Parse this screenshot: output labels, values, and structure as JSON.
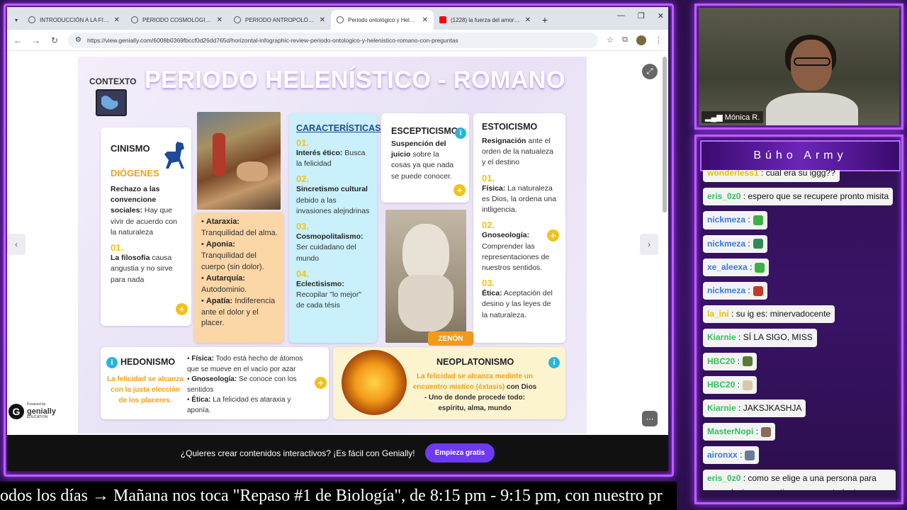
{
  "browser": {
    "tabs": [
      {
        "title": "INTRODUCCIÓN A LA FILOSOFÍ",
        "active": false
      },
      {
        "title": "PERIODO COSMOLÓGICO | Ge",
        "active": false
      },
      {
        "title": "PERIODO ANTROPOLÓGICO | G",
        "active": false
      },
      {
        "title": "Periodo ontológico y Helenístic",
        "active": true
      },
      {
        "title": "(1228) la fuerza del amor - You",
        "active": false
      }
    ],
    "url": "https://view.genially.com/6008b0369fbccf0d26dd765d/horizontal-infographic-review-periodo-ontologico-y-helenistico-romano-con-preguntas"
  },
  "infographic": {
    "title": "PERIODO HELENÍSTICO - ROMANO",
    "context_label": "CONTEXTO",
    "cinismo": {
      "title": "CINISMO",
      "subtitle": "DIÓGENES",
      "bold1": "Rechazo a las convencione sociales:",
      "text1": " Hay que vivir de acuerdo con la naturaleza",
      "num": "01.",
      "bold2": "La filosofía",
      "text2": " causa angustia y no sirve para nada"
    },
    "painting_list": [
      {
        "bold": "Ataraxia:",
        "text": " Tranquilidad del alma."
      },
      {
        "bold": "Aponia:",
        "text": " Tranquilidad del cuerpo (sin dolor)."
      },
      {
        "bold": "Autarquía:",
        "text": " Autodominio."
      },
      {
        "bold": "Apatía:",
        "text": " Indiferencia ante el dolor y el placer."
      }
    ],
    "caracteristicas": {
      "title": "CARACTERÍSTICAS",
      "items": [
        {
          "num": "01.",
          "bold": "Interés ético:",
          "text": " Busca la felicidad"
        },
        {
          "num": "02.",
          "bold": "Sincretismo cultural",
          "text": " debido a las invasiones alejndrinas"
        },
        {
          "num": "03.",
          "bold": "Cosmopolitalismo:",
          "text": " Ser cuidadano del mundo"
        },
        {
          "num": "04.",
          "bold": "Eclectisismo:",
          "text": " Recopilar \"lo mejor\" de cada tésis"
        }
      ]
    },
    "escepticismo": {
      "title": "ESCEPTICISMO",
      "bold": "Suspención del juicio",
      "text": " sobre la cosas ya que nada se puede conocer."
    },
    "zenon_label": "ZENÓN",
    "estoicismo": {
      "title": "ESTOICISMO",
      "bold1": "Resignación",
      "text1": " ante el orden de la natualeza y el destino",
      "items": [
        {
          "num": "01.",
          "bold": "Física:",
          "text": " La naturaleza es Dios, la ordena una intligencia."
        },
        {
          "num": "02.",
          "bold": "Gnoseología:",
          "text": " Comprender las representaciones de nuestros sentidos."
        },
        {
          "num": "03.",
          "bold": "Ética:",
          "text": " Aceptación del desino y las leyes de la naturaleza."
        }
      ]
    },
    "hedonismo": {
      "title": "HEDONISMO",
      "orange_text": "La felicidad se alcanza con la justa elección de los placeres.",
      "items": [
        {
          "bold": "Física:",
          "text": " Todo está hecho de átomos que se mueve en el vacío por azar"
        },
        {
          "bold": "Gnoseología:",
          "text": " Se conoce con los sentidos"
        },
        {
          "bold": "Ética:",
          "text": " La felicidad es ataraxia y aponía."
        }
      ]
    },
    "neoplatonismo": {
      "title": "NEOPLATONISMO",
      "orange_text": "La felicidad se alcanza medinte un encuentro mistico (éxtasis)",
      "text": " con Dios - Uno de donde procede todo: espíritu, alma, mundo"
    }
  },
  "genially": {
    "powered": "Powered by",
    "brand": "genially",
    "edu": "EDUCATION",
    "promo_text": "¿Quieres crear contenidos interactivos? ¡Es fácil con Genially!",
    "promo_button": "Empieza gratis"
  },
  "webcam": {
    "name": "Mónica R."
  },
  "chat": {
    "title": "Búho Army",
    "messages": [
      {
        "user": "wonderless1",
        "text": ": cual era su iggg??",
        "color": "yellow"
      },
      {
        "user": "eris_0z0",
        "text": ": espero que se recupere pronto misita",
        "color": "green"
      },
      {
        "user": "nickmeza",
        "text": ":",
        "emote": "#3cb043",
        "color": "blue"
      },
      {
        "user": "nickmeza",
        "text": ":",
        "emote": "#2e8b57",
        "color": "blue"
      },
      {
        "user": "xe_aleexa",
        "text": ":",
        "emote": "#3cb043",
        "color": "blue"
      },
      {
        "user": "nickmeza",
        "text": ":",
        "emote": "#c0392b",
        "color": "blue"
      },
      {
        "user": "la_ini",
        "text": ": su ig es: minervadocente",
        "color": "yellow"
      },
      {
        "user": "Kiarnie",
        "text": ": SÍ LA SIGO, MISS",
        "color": "green"
      },
      {
        "user": "HBC20",
        "text": ":",
        "emote": "#5a7a3a",
        "color": "green"
      },
      {
        "user": "HBC20",
        "text": ":",
        "emote": "#d9c8a8",
        "color": "green"
      },
      {
        "user": "Kiarnie",
        "text": ": JAKSJKASHJA",
        "color": "green"
      },
      {
        "user": "MasterNopi",
        "text": ":",
        "emote": "#8a6a5a",
        "color": "green"
      },
      {
        "user": "aironxx",
        "text": ":",
        "emote": "#6a7a9a",
        "color": "blue"
      },
      {
        "user": "eris_0z0",
        "text": ": como se elige a una persona para una relacion romantica ,segun usted miss",
        "color": "green"
      }
    ]
  },
  "ticker": {
    "text": "odos los días  →  Mañana nos toca \"Repaso #1 de Biología\", de 8:15 pm - 9:15 pm, con nuestro pr"
  }
}
